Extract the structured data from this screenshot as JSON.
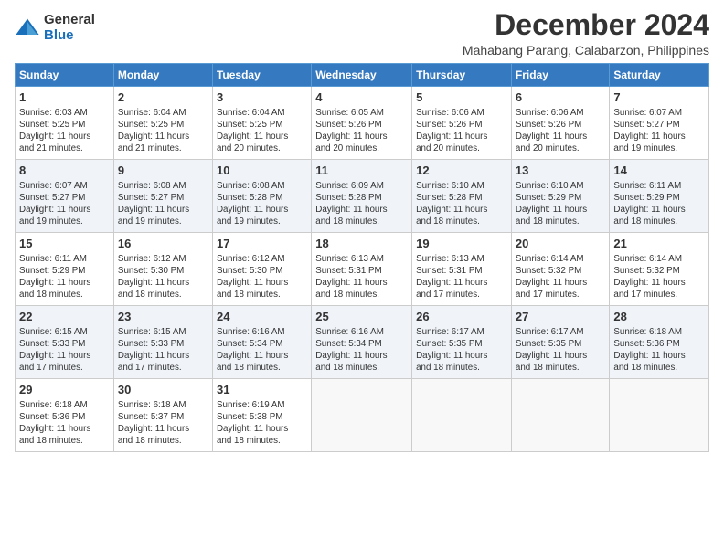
{
  "logo": {
    "general": "General",
    "blue": "Blue"
  },
  "title": "December 2024",
  "location": "Mahabang Parang, Calabarzon, Philippines",
  "days_of_week": [
    "Sunday",
    "Monday",
    "Tuesday",
    "Wednesday",
    "Thursday",
    "Friday",
    "Saturday"
  ],
  "weeks": [
    [
      {
        "day": "1",
        "info": "Sunrise: 6:03 AM\nSunset: 5:25 PM\nDaylight: 11 hours\nand 21 minutes."
      },
      {
        "day": "2",
        "info": "Sunrise: 6:04 AM\nSunset: 5:25 PM\nDaylight: 11 hours\nand 21 minutes."
      },
      {
        "day": "3",
        "info": "Sunrise: 6:04 AM\nSunset: 5:25 PM\nDaylight: 11 hours\nand 20 minutes."
      },
      {
        "day": "4",
        "info": "Sunrise: 6:05 AM\nSunset: 5:26 PM\nDaylight: 11 hours\nand 20 minutes."
      },
      {
        "day": "5",
        "info": "Sunrise: 6:06 AM\nSunset: 5:26 PM\nDaylight: 11 hours\nand 20 minutes."
      },
      {
        "day": "6",
        "info": "Sunrise: 6:06 AM\nSunset: 5:26 PM\nDaylight: 11 hours\nand 20 minutes."
      },
      {
        "day": "7",
        "info": "Sunrise: 6:07 AM\nSunset: 5:27 PM\nDaylight: 11 hours\nand 19 minutes."
      }
    ],
    [
      {
        "day": "8",
        "info": "Sunrise: 6:07 AM\nSunset: 5:27 PM\nDaylight: 11 hours\nand 19 minutes."
      },
      {
        "day": "9",
        "info": "Sunrise: 6:08 AM\nSunset: 5:27 PM\nDaylight: 11 hours\nand 19 minutes."
      },
      {
        "day": "10",
        "info": "Sunrise: 6:08 AM\nSunset: 5:28 PM\nDaylight: 11 hours\nand 19 minutes."
      },
      {
        "day": "11",
        "info": "Sunrise: 6:09 AM\nSunset: 5:28 PM\nDaylight: 11 hours\nand 18 minutes."
      },
      {
        "day": "12",
        "info": "Sunrise: 6:10 AM\nSunset: 5:28 PM\nDaylight: 11 hours\nand 18 minutes."
      },
      {
        "day": "13",
        "info": "Sunrise: 6:10 AM\nSunset: 5:29 PM\nDaylight: 11 hours\nand 18 minutes."
      },
      {
        "day": "14",
        "info": "Sunrise: 6:11 AM\nSunset: 5:29 PM\nDaylight: 11 hours\nand 18 minutes."
      }
    ],
    [
      {
        "day": "15",
        "info": "Sunrise: 6:11 AM\nSunset: 5:29 PM\nDaylight: 11 hours\nand 18 minutes."
      },
      {
        "day": "16",
        "info": "Sunrise: 6:12 AM\nSunset: 5:30 PM\nDaylight: 11 hours\nand 18 minutes."
      },
      {
        "day": "17",
        "info": "Sunrise: 6:12 AM\nSunset: 5:30 PM\nDaylight: 11 hours\nand 18 minutes."
      },
      {
        "day": "18",
        "info": "Sunrise: 6:13 AM\nSunset: 5:31 PM\nDaylight: 11 hours\nand 18 minutes."
      },
      {
        "day": "19",
        "info": "Sunrise: 6:13 AM\nSunset: 5:31 PM\nDaylight: 11 hours\nand 17 minutes."
      },
      {
        "day": "20",
        "info": "Sunrise: 6:14 AM\nSunset: 5:32 PM\nDaylight: 11 hours\nand 17 minutes."
      },
      {
        "day": "21",
        "info": "Sunrise: 6:14 AM\nSunset: 5:32 PM\nDaylight: 11 hours\nand 17 minutes."
      }
    ],
    [
      {
        "day": "22",
        "info": "Sunrise: 6:15 AM\nSunset: 5:33 PM\nDaylight: 11 hours\nand 17 minutes."
      },
      {
        "day": "23",
        "info": "Sunrise: 6:15 AM\nSunset: 5:33 PM\nDaylight: 11 hours\nand 17 minutes."
      },
      {
        "day": "24",
        "info": "Sunrise: 6:16 AM\nSunset: 5:34 PM\nDaylight: 11 hours\nand 18 minutes."
      },
      {
        "day": "25",
        "info": "Sunrise: 6:16 AM\nSunset: 5:34 PM\nDaylight: 11 hours\nand 18 minutes."
      },
      {
        "day": "26",
        "info": "Sunrise: 6:17 AM\nSunset: 5:35 PM\nDaylight: 11 hours\nand 18 minutes."
      },
      {
        "day": "27",
        "info": "Sunrise: 6:17 AM\nSunset: 5:35 PM\nDaylight: 11 hours\nand 18 minutes."
      },
      {
        "day": "28",
        "info": "Sunrise: 6:18 AM\nSunset: 5:36 PM\nDaylight: 11 hours\nand 18 minutes."
      }
    ],
    [
      {
        "day": "29",
        "info": "Sunrise: 6:18 AM\nSunset: 5:36 PM\nDaylight: 11 hours\nand 18 minutes."
      },
      {
        "day": "30",
        "info": "Sunrise: 6:18 AM\nSunset: 5:37 PM\nDaylight: 11 hours\nand 18 minutes."
      },
      {
        "day": "31",
        "info": "Sunrise: 6:19 AM\nSunset: 5:38 PM\nDaylight: 11 hours\nand 18 minutes."
      },
      {
        "day": "",
        "info": ""
      },
      {
        "day": "",
        "info": ""
      },
      {
        "day": "",
        "info": ""
      },
      {
        "day": "",
        "info": ""
      }
    ]
  ]
}
